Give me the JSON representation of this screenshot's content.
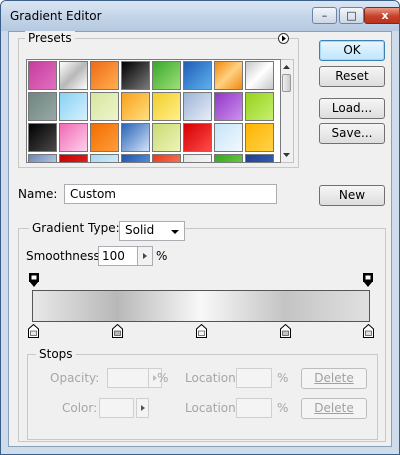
{
  "window": {
    "title": "Gradient Editor"
  },
  "titlebar": {
    "minimize": "–",
    "maximize": "□",
    "close": "x"
  },
  "presets": {
    "label": "Presets",
    "swatches": [
      "linear-gradient(135deg,#c73c9e,#e070c0)",
      "linear-gradient(135deg,#ffffff,#b8b8b8,#ffffff)",
      "linear-gradient(135deg,#f06a16,#ffb050)",
      "linear-gradient(135deg,#000000,#7a7a7a)",
      "linear-gradient(135deg,#3aa82a,#9ee07a)",
      "linear-gradient(135deg,#1f5fb5,#5fb0f0)",
      "linear-gradient(135deg,#f08a10,#ffd080,#f08a10)",
      "linear-gradient(135deg,#c8c8c8,#ffffff,#c8c8c8)",
      "linear-gradient(135deg,#6f8580,#97a9a4)",
      "linear-gradient(135deg,#88d2f4,#d6f0ff)",
      "linear-gradient(135deg,#d6e6a0,#eef5cc)",
      "linear-gradient(135deg,#f9a01a,#ffe080)",
      "linear-gradient(135deg,#f2cd2a,#fff08a)",
      "linear-gradient(135deg,#9db3d6,#e7eef8)",
      "linear-gradient(135deg,#8e38c4,#cf90f0)",
      "linear-gradient(135deg,#96d21a,#c6f070)",
      "linear-gradient(135deg,#000000,#4a4a4a)",
      "linear-gradient(135deg,#f06ab6,#ffd0ea)",
      "linear-gradient(135deg,#f26d00,#ff9d3a)",
      "linear-gradient(135deg,#2a64b6,#d0e2f8)",
      "linear-gradient(135deg,#c9db74,#eef4b8)",
      "linear-gradient(135deg,#d40000,#ff4a4a)",
      "linear-gradient(135deg,#c6e4f8,#f2f9ff)",
      "linear-gradient(135deg,#ffb400,#ffd24a)",
      "linear-gradient(135deg,#6a86b6,#e0e8f4)",
      "linear-gradient(135deg,#cc0000,#e03030)",
      "linear-gradient(135deg,#a8d8f0,#e6f6ff)",
      "linear-gradient(135deg,#1a56b0,#78a8e8)",
      "linear-gradient(135deg,#e83a1a,#ff9070)",
      "linear-gradient(135deg,#e4e4e4,#ffffff)",
      "linear-gradient(135deg,#36a81a,#7ad85a)",
      "linear-gradient(135deg,#1f3f90,#3a6ac0)"
    ]
  },
  "buttons": {
    "ok": "OK",
    "reset": "Reset",
    "load": "Load...",
    "save": "Save...",
    "new": "New",
    "delete_opacity": "Delete",
    "delete_color": "Delete"
  },
  "name": {
    "label": "Name:",
    "value": "Custom"
  },
  "gradient": {
    "legend": "Gradient Type:",
    "type_value": "Solid",
    "smoothness_label": "Smoothness:",
    "smoothness_value": "100",
    "smoothness_unit": "%",
    "colors": [
      "#e8e8e8",
      "#b8b8b8",
      "#f8f8f8",
      "#c4c4c4",
      "#e0e0e0"
    ]
  },
  "stops": {
    "legend": "Stops",
    "opacity_label": "Opacity:",
    "opacity_unit": "%",
    "color_label": "Color:",
    "location_label_1": "Location:",
    "location_label_2": "Location:",
    "location_unit_1": "%",
    "location_unit_2": "%"
  }
}
